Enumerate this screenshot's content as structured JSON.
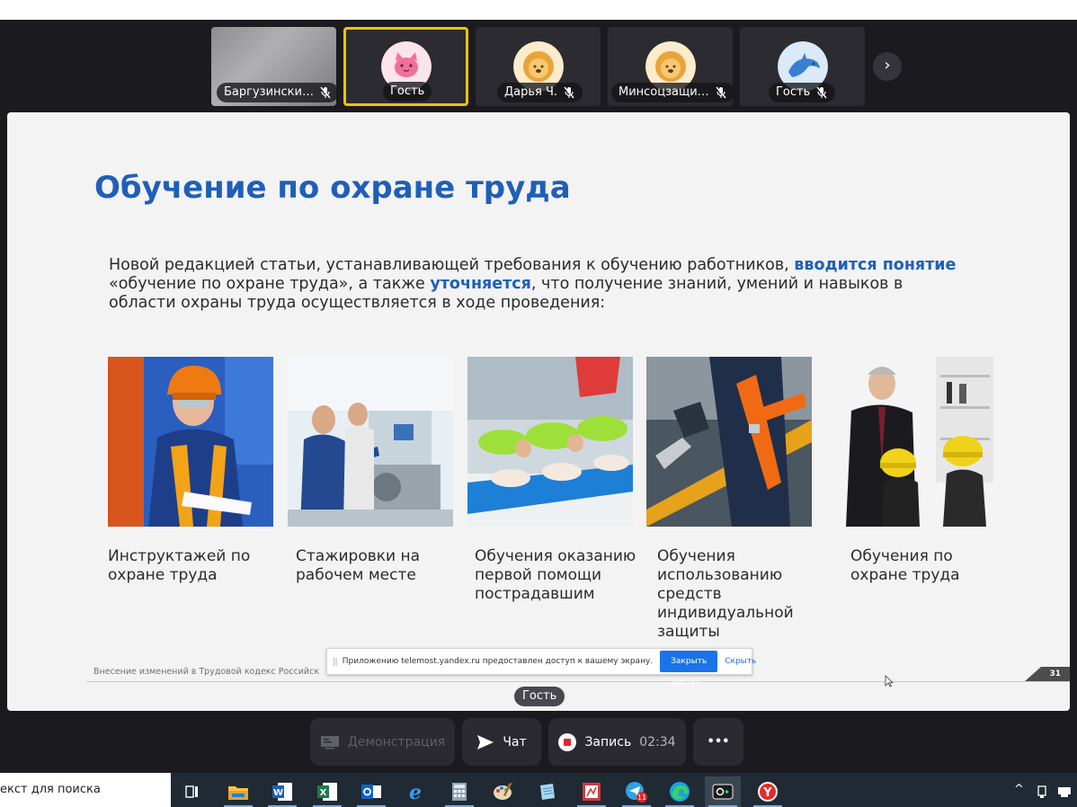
{
  "participants": [
    {
      "name": "Баргузински…",
      "muted": true
    },
    {
      "name": "Гость",
      "muted": false,
      "active": true
    },
    {
      "name": "Дарья Ч.",
      "muted": true
    },
    {
      "name": "Минсоцзащи…",
      "muted": true
    },
    {
      "name": "Гость",
      "muted": true
    }
  ],
  "slide": {
    "title": "Обучение по охране труда",
    "intro_1": "Новой редакцией статьи, устанавливающей требования к обучению работников, ",
    "intro_bold_1": "вводится понятие",
    "intro_2": " «обучение по охране труда», а также ",
    "intro_bold_2": "уточняется",
    "intro_3": ", что получение знаний, умений и навыков в области охраны труда осуществляется в ходе проведения:",
    "items": [
      {
        "caption": "Инструктажей по охране труда"
      },
      {
        "caption": "Стажировки на рабочем месте"
      },
      {
        "caption": "Обучения оказанию первой помощи пострадавшим"
      },
      {
        "caption": "Обучения использованию средств индивидуальной защиты"
      },
      {
        "caption": "Обучения по охране труда"
      }
    ],
    "footer": "Внесение изменений в Трудовой кодекс Российск",
    "page_number": "31"
  },
  "share_notice": {
    "message": "Приложению telemost.yandex.ru предоставлен доступ к вашему экрану.",
    "stop_label": "Закрыть доступ",
    "hide_label": "Скрыть"
  },
  "speaker_label": "Гость",
  "controls": {
    "demo_label": "Демонстрация",
    "chat_label": "Чат",
    "record_label": "Запись",
    "record_time": "02:34",
    "more_label": "•••"
  },
  "taskbar": {
    "search_text": "екст для поиска",
    "telegram_badge": "11"
  },
  "colors": {
    "accent_blue": "#1f5fb8",
    "active_border": "#f2c300",
    "record_red": "#e0262b"
  }
}
